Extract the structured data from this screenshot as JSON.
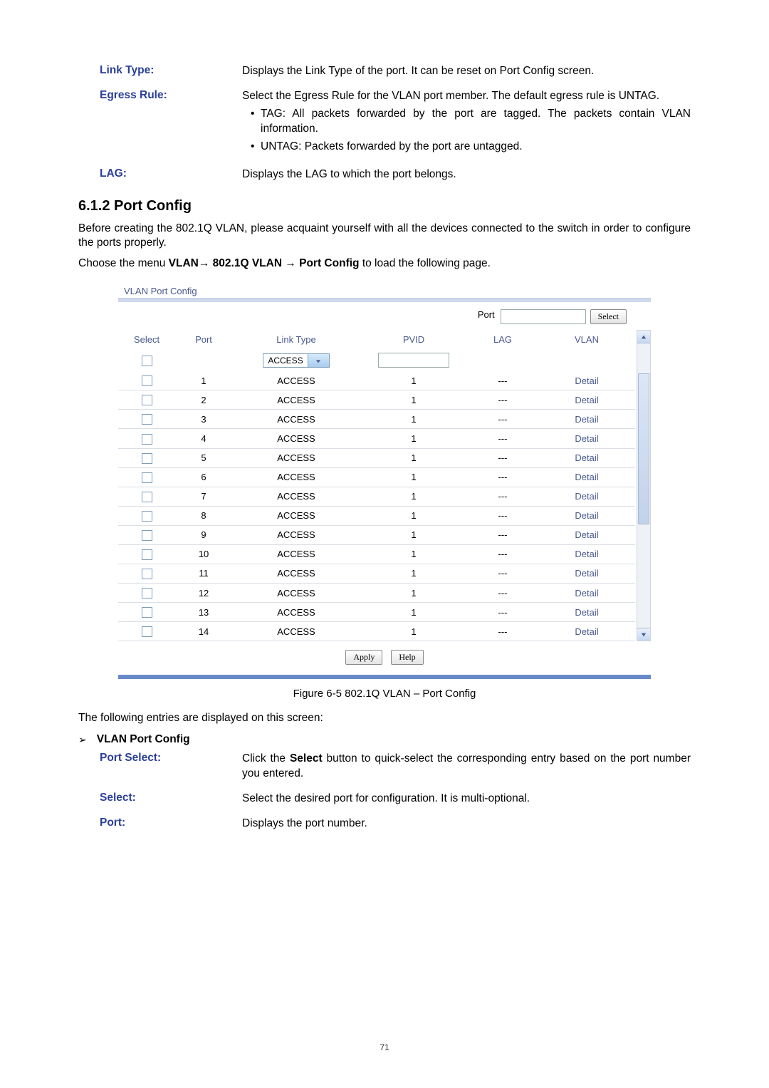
{
  "definitions_top": {
    "link_type": {
      "term": "Link Type:",
      "desc": "Displays the Link Type of the port. It can be reset on Port Config screen."
    },
    "egress_rule": {
      "term": "Egress Rule:",
      "desc": "Select the Egress Rule for the VLAN port member. The default egress rule is UNTAG.",
      "bullets": [
        "TAG: All packets forwarded by the port are tagged. The packets contain VLAN information.",
        "UNTAG: Packets forwarded by the port are untagged."
      ]
    },
    "lag": {
      "term": "LAG:",
      "desc": "Displays the LAG to which the port belongs."
    }
  },
  "section_title": "6.1.2 Port Config",
  "para1": "Before creating the 802.1Q VLAN, please acquaint yourself with all the devices connected to the switch in order to configure the ports properly.",
  "para2_pre": "Choose the menu ",
  "para2_bold": "VLAN→ 802.1Q VLAN → Port Config",
  "para2_post": " to load the following page.",
  "screenshot": {
    "panel_title": "VLAN Port Config",
    "port_label": "Port",
    "select_btn": "Select",
    "headers": {
      "select": "Select",
      "port": "Port",
      "linktype": "Link Type",
      "pvid": "PVID",
      "lag": "LAG",
      "vlan": "VLAN"
    },
    "linktype_value": "ACCESS",
    "rows": [
      {
        "port": "1",
        "link": "ACCESS",
        "pvid": "1",
        "lag": "---",
        "vlan": "Detail"
      },
      {
        "port": "2",
        "link": "ACCESS",
        "pvid": "1",
        "lag": "---",
        "vlan": "Detail"
      },
      {
        "port": "3",
        "link": "ACCESS",
        "pvid": "1",
        "lag": "---",
        "vlan": "Detail"
      },
      {
        "port": "4",
        "link": "ACCESS",
        "pvid": "1",
        "lag": "---",
        "vlan": "Detail"
      },
      {
        "port": "5",
        "link": "ACCESS",
        "pvid": "1",
        "lag": "---",
        "vlan": "Detail"
      },
      {
        "port": "6",
        "link": "ACCESS",
        "pvid": "1",
        "lag": "---",
        "vlan": "Detail"
      },
      {
        "port": "7",
        "link": "ACCESS",
        "pvid": "1",
        "lag": "---",
        "vlan": "Detail"
      },
      {
        "port": "8",
        "link": "ACCESS",
        "pvid": "1",
        "lag": "---",
        "vlan": "Detail"
      },
      {
        "port": "9",
        "link": "ACCESS",
        "pvid": "1",
        "lag": "---",
        "vlan": "Detail"
      },
      {
        "port": "10",
        "link": "ACCESS",
        "pvid": "1",
        "lag": "---",
        "vlan": "Detail"
      },
      {
        "port": "11",
        "link": "ACCESS",
        "pvid": "1",
        "lag": "---",
        "vlan": "Detail"
      },
      {
        "port": "12",
        "link": "ACCESS",
        "pvid": "1",
        "lag": "---",
        "vlan": "Detail"
      },
      {
        "port": "13",
        "link": "ACCESS",
        "pvid": "1",
        "lag": "---",
        "vlan": "Detail"
      },
      {
        "port": "14",
        "link": "ACCESS",
        "pvid": "1",
        "lag": "---",
        "vlan": "Detail"
      }
    ],
    "apply_btn": "Apply",
    "help_btn": "Help"
  },
  "figure_caption": "Figure 6-5 802.1Q VLAN – Port Config",
  "entries_intro": "The following entries are displayed on this screen:",
  "sub_heading": "VLAN Port Config",
  "definitions_bottom": {
    "port_select": {
      "term": "Port Select:",
      "desc_pre": "Click the ",
      "desc_bold": "Select",
      "desc_post": " button to quick-select the corresponding entry based on the port number you entered."
    },
    "select": {
      "term": "Select:",
      "desc": "Select the desired port for configuration. It is multi-optional."
    },
    "port": {
      "term": "Port:",
      "desc": "Displays the port number."
    }
  },
  "page_number": "71"
}
